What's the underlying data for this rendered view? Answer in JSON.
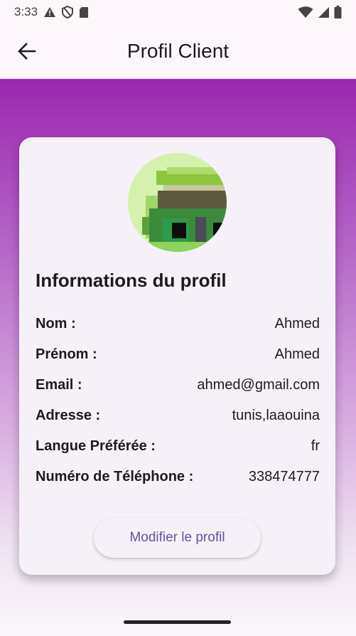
{
  "status_bar": {
    "time": "3:33",
    "icons_left": [
      "warning-icon",
      "shield-icon",
      "sd-card-icon"
    ],
    "icons_right": [
      "wifi-icon",
      "signal-icon",
      "battery-icon"
    ]
  },
  "app_bar": {
    "title": "Profil Client",
    "back_icon": "arrow-back-icon"
  },
  "profile": {
    "section_title": "Informations du profil",
    "fields": [
      {
        "label": "Nom :",
        "value": "Ahmed"
      },
      {
        "label": "Prénom :",
        "value": "Ahmed"
      },
      {
        "label": "Email :",
        "value": "ahmed@gmail.com"
      },
      {
        "label": "Adresse :",
        "value": "tunis,laaouina"
      },
      {
        "label": "Langue Préférée :",
        "value": "fr"
      },
      {
        "label": "Numéro de Téléphone :",
        "value": "338474777"
      }
    ],
    "edit_button_label": "Modifier le profil"
  },
  "colors": {
    "accent": "#6750a4",
    "gradient_top": "#9c27b0",
    "card_bg": "#f6f1f8"
  }
}
